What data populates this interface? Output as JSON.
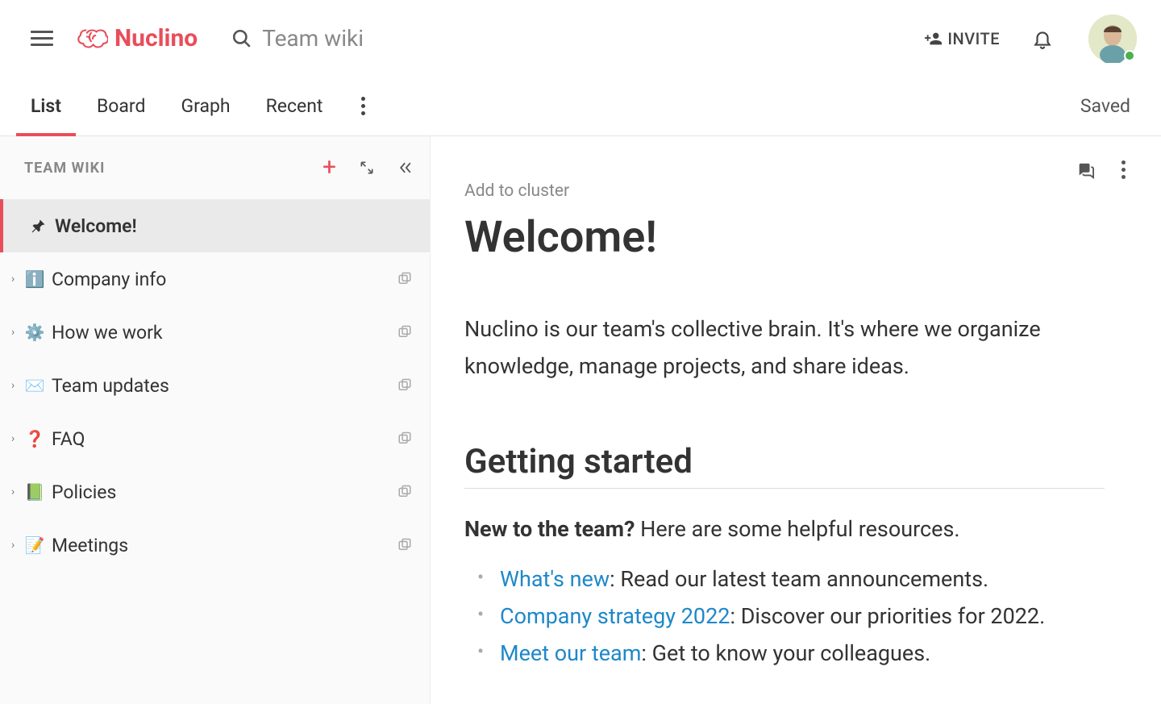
{
  "header": {
    "brand": "Nuclino",
    "search_placeholder": "Team wiki",
    "invite_label": "INVITE"
  },
  "tabs": {
    "items": [
      "List",
      "Board",
      "Graph",
      "Recent"
    ],
    "active_index": 0,
    "status": "Saved"
  },
  "sidebar": {
    "title": "TEAM WIKI",
    "items": [
      {
        "icon": "pin",
        "label": "Welcome!",
        "has_children": false,
        "is_cluster": false
      },
      {
        "icon": "ℹ️",
        "label": "Company info",
        "has_children": true,
        "is_cluster": true
      },
      {
        "icon": "⚙️",
        "label": "How we work",
        "has_children": true,
        "is_cluster": true
      },
      {
        "icon": "✉️",
        "label": "Team updates",
        "has_children": true,
        "is_cluster": true
      },
      {
        "icon": "❓",
        "label": "FAQ",
        "has_children": true,
        "is_cluster": true
      },
      {
        "icon": "📗",
        "label": "Policies",
        "has_children": true,
        "is_cluster": true
      },
      {
        "icon": "📝",
        "label": "Meetings",
        "has_children": true,
        "is_cluster": true
      }
    ],
    "active_index": 0
  },
  "doc": {
    "add_cluster": "Add to cluster",
    "title": "Welcome!",
    "intro": "Nuclino is our team's collective brain. It's where we organize knowledge, manage projects, and share ideas.",
    "section_heading": "Getting started",
    "new_lead_bold": "New to the team?",
    "new_lead_rest": " Here are some helpful resources.",
    "bullets": [
      {
        "link": "What's new",
        "rest": ": Read our latest team announcements."
      },
      {
        "link": "Company strategy 2022",
        "rest": ": Discover our priorities for 2022."
      },
      {
        "link": "Meet our team",
        "rest": ": Get to know your colleagues."
      }
    ]
  },
  "colors": {
    "accent": "#e84e5a",
    "link": "#1e88c9"
  }
}
